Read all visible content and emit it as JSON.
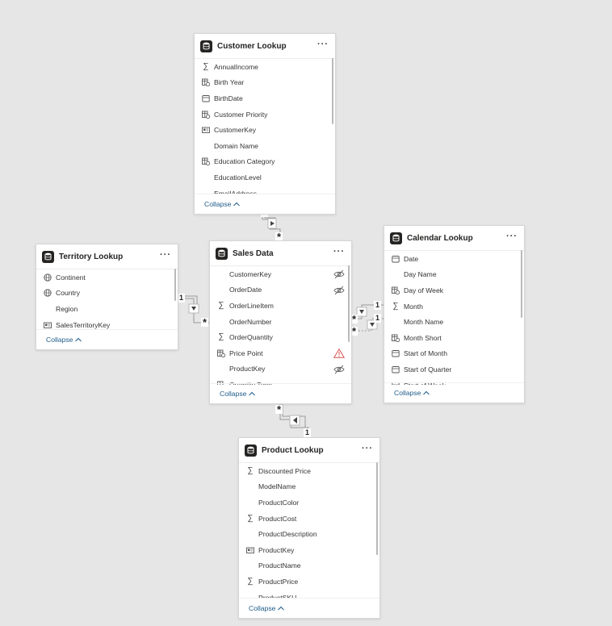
{
  "theme": {
    "background": "#e6e6e6",
    "card": "#ffffff",
    "link": "#1f5c8a",
    "warning": "#d9534f"
  },
  "collapse_label": "Collapse",
  "tables": {
    "customer": {
      "title": "Customer Lookup",
      "fields": [
        {
          "name": "AnnualIncome",
          "icon": "sigma-icon"
        },
        {
          "name": "Birth Year",
          "icon": "calculated-column-icon"
        },
        {
          "name": "BirthDate",
          "icon": "calendar-icon"
        },
        {
          "name": "Customer Priority",
          "icon": "calculated-column-icon"
        },
        {
          "name": "CustomerKey",
          "icon": "key-card-icon"
        },
        {
          "name": "Domain Name",
          "icon": ""
        },
        {
          "name": "Education Category",
          "icon": "calculated-column-icon"
        },
        {
          "name": "EducationLevel",
          "icon": ""
        },
        {
          "name": "EmailAddress",
          "icon": ""
        }
      ]
    },
    "territory": {
      "title": "Territory Lookup",
      "fields": [
        {
          "name": "Continent",
          "icon": "globe-icon"
        },
        {
          "name": "Country",
          "icon": "globe-icon"
        },
        {
          "name": "Region",
          "icon": ""
        },
        {
          "name": "SalesTerritoryKey",
          "icon": "key-card-icon"
        }
      ]
    },
    "sales": {
      "title": "Sales Data",
      "fields": [
        {
          "name": "CustomerKey",
          "icon": "",
          "status": "hidden-eye-icon"
        },
        {
          "name": "OrderDate",
          "icon": "",
          "status": "hidden-eye-icon"
        },
        {
          "name": "OrderLineItem",
          "icon": "sigma-icon"
        },
        {
          "name": "OrderNumber",
          "icon": ""
        },
        {
          "name": "OrderQuantity",
          "icon": "sigma-icon"
        },
        {
          "name": "Price Point",
          "icon": "calculated-column-icon",
          "status": "warning-icon"
        },
        {
          "name": "ProductKey",
          "icon": "",
          "status": "hidden-eye-icon"
        },
        {
          "name": "Quantity Type",
          "icon": "calculated-column-icon"
        }
      ]
    },
    "calendar": {
      "title": "Calendar Lookup",
      "fields": [
        {
          "name": "Date",
          "icon": "calendar-icon"
        },
        {
          "name": "Day Name",
          "icon": ""
        },
        {
          "name": "Day of Week",
          "icon": "calculated-column-icon"
        },
        {
          "name": "Month",
          "icon": "sigma-icon"
        },
        {
          "name": "Month Name",
          "icon": ""
        },
        {
          "name": "Month Short",
          "icon": "calculated-column-icon"
        },
        {
          "name": "Start of Month",
          "icon": "calendar-icon"
        },
        {
          "name": "Start of Quarter",
          "icon": "calendar-icon"
        },
        {
          "name": "Start of Week",
          "icon": "calendar-icon"
        }
      ]
    },
    "product": {
      "title": "Product Lookup",
      "fields": [
        {
          "name": "Discounted Price",
          "icon": "sigma-icon"
        },
        {
          "name": "ModelName",
          "icon": ""
        },
        {
          "name": "ProductColor",
          "icon": ""
        },
        {
          "name": "ProductCost",
          "icon": "sigma-icon"
        },
        {
          "name": "ProductDescription",
          "icon": ""
        },
        {
          "name": "ProductKey",
          "icon": "key-card-icon"
        },
        {
          "name": "ProductName",
          "icon": ""
        },
        {
          "name": "ProductPrice",
          "icon": "sigma-icon"
        },
        {
          "name": "ProductSKU",
          "icon": ""
        }
      ]
    }
  },
  "relationships": {
    "one": "1",
    "many": "*"
  }
}
